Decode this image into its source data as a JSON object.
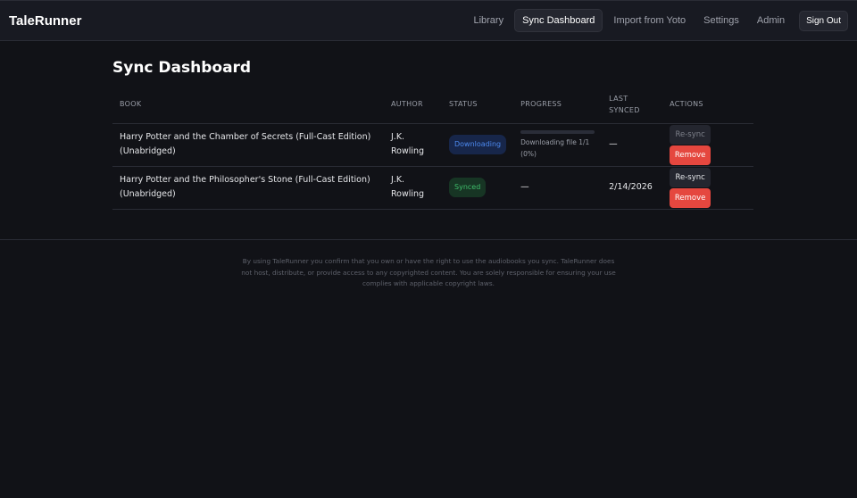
{
  "app": {
    "brand": "TaleRunner"
  },
  "nav": {
    "items": [
      {
        "label": "Library"
      },
      {
        "label": "Sync Dashboard"
      },
      {
        "label": "Import from Yoto"
      },
      {
        "label": "Settings"
      },
      {
        "label": "Admin"
      }
    ],
    "sign_out": "Sign Out"
  },
  "page": {
    "title": "Sync Dashboard"
  },
  "table": {
    "headers": {
      "book": "BOOK",
      "author": "AUTHOR",
      "status": "STATUS",
      "progress": "PROGRESS",
      "last_synced": "LAST SYNCED",
      "actions": "ACTIONS"
    },
    "rows": [
      {
        "book": "Harry Potter and the Chamber of Secrets (Full-Cast Edition) (Unabridged)",
        "author": "J.K. Rowling",
        "status": "Downloading",
        "progress_text": "Downloading file 1/1 (0%)",
        "progress_percent": 0,
        "last_synced": "—",
        "resync": "Re-sync",
        "remove": "Remove"
      },
      {
        "book": "Harry Potter and the Philosopher's Stone (Full-Cast Edition) (Unabridged)",
        "author": "J.K. Rowling",
        "status": "Synced",
        "progress_text": "—",
        "last_synced": "2/14/2026",
        "resync": "Re-sync",
        "remove": "Remove"
      }
    ]
  },
  "footer": {
    "disclaimer": "By using TaleRunner you confirm that you own or have the right to use the audiobooks you sync. TaleRunner does not host, distribute, or provide access to any copyrighted content. You are solely responsible for ensuring your use complies with applicable copyright laws."
  }
}
